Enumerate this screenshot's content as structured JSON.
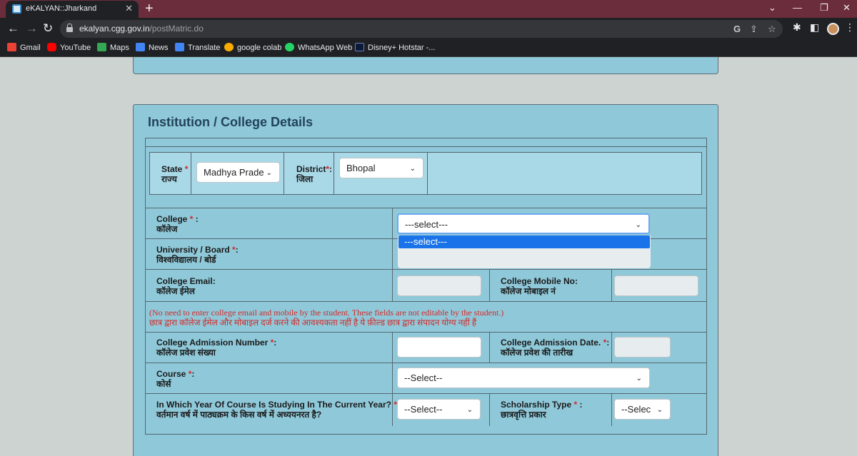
{
  "browser": {
    "tab_title": "eKALYAN::Jharkand",
    "tab_close": "✕",
    "new_tab": "+",
    "url_host": "ekalyan.cgg.gov.in",
    "url_path": "/postMatric.do",
    "bookmarks": [
      "Gmail",
      "YouTube",
      "Maps",
      "News",
      "Translate",
      "google colab",
      "WhatsApp Web",
      "Disney+ Hotstar -..."
    ]
  },
  "section": {
    "title": "Institution / College Details"
  },
  "state": {
    "label": "State",
    "required": "*",
    "label_hi": "राज्य",
    "value": "Madhya Prade"
  },
  "district": {
    "label": "District",
    "required": "*",
    "colon": ":",
    "label_hi": "जिला",
    "value": "Bhopal"
  },
  "college": {
    "label": "College",
    "required": "*",
    "colon": " :",
    "label_hi": "कॉलेज",
    "value": "---select---",
    "options": [
      "---select---"
    ]
  },
  "university": {
    "label": "University / Board",
    "required": "*",
    "colon": ":",
    "label_hi": "विश्वविद्यालय / बोर्ड"
  },
  "college_email": {
    "label": "College Email:",
    "label_hi": "कॉलेज ईमेल"
  },
  "college_mobile": {
    "label": "College Mobile No:",
    "label_hi": "कॉलेज मोबाइल नं"
  },
  "note": {
    "en": "(No need to enter college email and mobile by the student. These fields are not editable by the student.)",
    "hi": "छात्र द्वारा कॉलेज ईमेल और मोबाइल दर्ज करने की आवश्यकता नहीं है ये फ़ील्ड छात्र द्वारा संपादन योग्य नहीं हैं"
  },
  "admission_number": {
    "label": "College Admission Number",
    "required": "*",
    "colon": ":",
    "label_hi": "कॉलेज प्रवेश संख्या"
  },
  "admission_date": {
    "label": "College Admission Date.",
    "required": "*",
    "colon": ":",
    "label_hi": "कॉलेज प्रवेश की तारीख"
  },
  "course": {
    "label": "Course",
    "required": "*",
    "colon": ":",
    "label_hi": "कोर्स",
    "value": "--Select--"
  },
  "year_of_course": {
    "label": "In Which Year Of Course Is Studying In The Current Year?",
    "required": "*",
    "colon": ":",
    "label_hi": "वर्तमान वर्ष में पाठ्यक्रम के किस वर्ष में अध्ययनरत है?",
    "value": "--Select--"
  },
  "scholarship_type": {
    "label": "Scholarship Type",
    "required": "*",
    "colon": " :",
    "label_hi": "छात्रवृत्ति प्रकार",
    "value": "--Selec"
  },
  "icons": {
    "chevron": "⌄",
    "back": "←",
    "forward": "→",
    "reload": "↻"
  }
}
